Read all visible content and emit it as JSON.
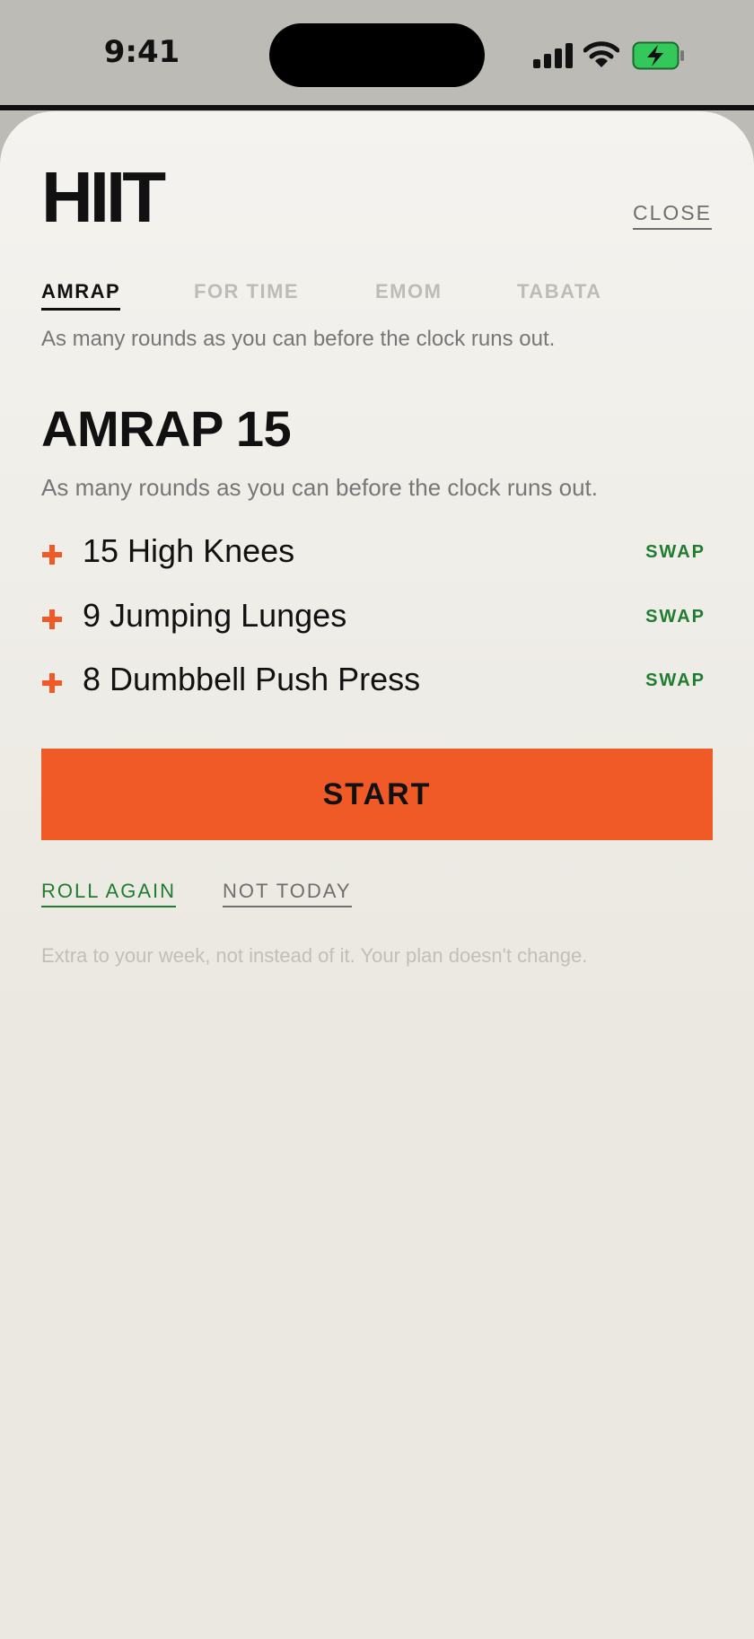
{
  "status_bar": {
    "time": "9:41",
    "icons": [
      "signal-icon",
      "wifi-icon",
      "battery-charging-icon"
    ],
    "battery_color": "#34c759"
  },
  "sheet": {
    "title": "HIIT",
    "close_label": "CLOSE",
    "tabs": [
      {
        "label": "AMRAP",
        "active": true
      },
      {
        "label": "FOR TIME",
        "active": false
      },
      {
        "label": "EMOM",
        "active": false
      },
      {
        "label": "TABATA",
        "active": false
      }
    ],
    "tab_description": "As many rounds as you can before the clock runs out.",
    "workout": {
      "title": "AMRAP 15",
      "description": "As many rounds as you can before the clock runs out.",
      "exercises": [
        {
          "name": "15 High Knees",
          "action": "SWAP"
        },
        {
          "name": "9 Jumping Lunges",
          "action": "SWAP"
        },
        {
          "name": "8 Dumbbell Push Press",
          "action": "SWAP"
        }
      ]
    },
    "start_label": "START",
    "roll_again_label": "ROLL AGAIN",
    "not_today_label": "NOT TODAY",
    "footnote": "Extra to your week, not instead of it. Your plan doesn't change."
  },
  "colors": {
    "accent": "#f05a26",
    "link_green": "#1f7d32",
    "text_primary": "#111111",
    "text_muted": "#777777"
  }
}
